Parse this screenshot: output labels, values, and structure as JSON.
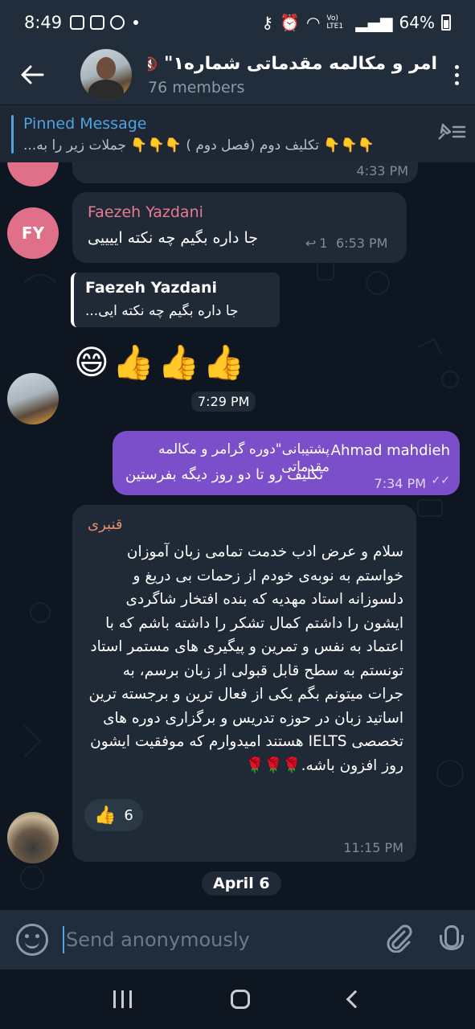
{
  "status_bar": {
    "time": "8:49",
    "battery": "64%",
    "network": "Vo) LTE1"
  },
  "header": {
    "title": "امر و مکالمه مقدماتی شماره۱\"",
    "members": "76 members"
  },
  "pinned": {
    "title": "Pinned Message",
    "body": "👇👇👇 تکلیف دوم (فصل دوم ) 👇👇👇 جملات زیر را به..."
  },
  "messages": {
    "top_time": "4:33 PM",
    "faezeh": {
      "avatar_initials": "FY",
      "sender": "Faezeh Yazdani",
      "text": "جا داره بگیم چه نکته اییییی",
      "reply_count": "1",
      "time": "6:53 PM"
    },
    "reply_msg": {
      "quote_sender": "Faezeh Yazdani",
      "quote_text": "جا داره بگیم چه نکته ایی...",
      "emojis": "😄👍👍👍",
      "time": "7:29 PM"
    },
    "outgoing": {
      "forward_from": "Ahmad mahdieh",
      "forward_title": "پشتیبانی\"دوره گرامر و مکالمه مقدماتی",
      "text": "تکلیف رو تا دو روز دیگه بفرستین",
      "time": "7:34 PM"
    },
    "ghanbari": {
      "sender": "قنبری",
      "text": "سلام و عرض ادب خدمت تمامی زبان آموزان خواستم به نوبه‌ی خودم از زحمات بی دریغ و دلسوزانه استاد مهدیه که بنده افتخار شاگردی ایشون را داشتم کمال تشکر را داشته باشم که با اعتماد به نفس  و تمرین و پیگیری های مستمر استاد تونستم به سطح قابل قبولی از زبان برسم، به جرات میتونم بگم یکی از فعال ترین و برجسته ترین اساتید زبان در حوزه تدریس و برگزاری دوره های تخصصی IELTS هستند امیدوارم که موفقیت ایشون روز افزون باشه.🌹🌹🌹",
      "reaction_emoji": "👍",
      "reaction_count": "6",
      "time": "11:15 PM"
    },
    "date_chip": "April 6"
  },
  "input": {
    "placeholder": "Send anonymously"
  },
  "colors": {
    "bg": "#0e1621",
    "bubble_in": "#1f2a36",
    "bubble_out": "#7b4fc9",
    "accent": "#4fa3e0",
    "faezeh_name": "#e97a8f",
    "ghanbari_name": "#e98a6c"
  }
}
